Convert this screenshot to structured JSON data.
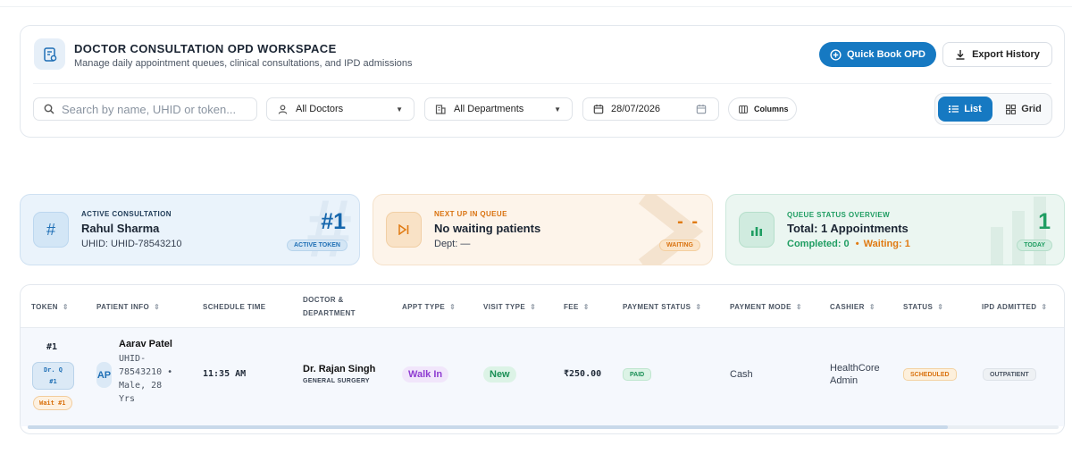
{
  "header": {
    "title": "DOCTOR CONSULTATION OPD WORKSPACE",
    "subtitle": "Manage daily appointment queues, clinical consultations, and IPD admissions",
    "quick_book_label": "Quick Book OPD",
    "export_label": "Export History"
  },
  "filters": {
    "search_placeholder": "Search by name, UHID or token...",
    "doctor_value": "All Doctors",
    "department_value": "All Departments",
    "date_value": "28/07/2026",
    "columns_label": "Columns",
    "view_list_label": "List",
    "view_grid_label": "Grid"
  },
  "stats": {
    "active": {
      "label": "ACTIVE CONSULTATION",
      "name": "Rahul Sharma",
      "uhid": "UHID: UHID-78543210",
      "big": "#1",
      "badge": "ACTIVE TOKEN",
      "watermark": "#"
    },
    "next": {
      "label": "NEXT UP IN QUEUE",
      "main": "No waiting patients",
      "dept": "Dept: —",
      "big": "- -",
      "badge": "WAITING"
    },
    "overview": {
      "label": "QUEUE STATUS OVERVIEW",
      "main": "Total: 1 Appointments",
      "completed": "Completed: 0",
      "waiting": "Waiting: 1",
      "big": "1",
      "badge": "TODAY"
    }
  },
  "table": {
    "columns": [
      "TOKEN",
      "PATIENT INFO",
      "SCHEDULE TIME",
      "DOCTOR &",
      "DEPARTMENT",
      "APPT TYPE",
      "VISIT TYPE",
      "FEE",
      "PAYMENT STATUS",
      "PAYMENT MODE",
      "CASHIER",
      "STATUS",
      "IPD ADMITTED"
    ],
    "row": {
      "token": "#1",
      "doctor_queue_line1": "Dr. Q",
      "doctor_queue_line2": "#1",
      "wait": "Wait #1",
      "avatar": "AP",
      "patient_name": "Aarav Patel",
      "patient_line1": "UHID-",
      "patient_line2": "78543210 •",
      "patient_line3": "Male, 28",
      "patient_line4": "Yrs",
      "time": "11:35 AM",
      "doctor_name": "Dr. Rajan Singh",
      "department": "GENERAL SURGERY",
      "appt_type": "Walk In",
      "visit_type": "New",
      "fee": "₹250.00",
      "payment_status": "PAID",
      "payment_mode": "Cash",
      "cashier_line1": "HealthCore",
      "cashier_line2": "Admin",
      "status": "SCHEDULED",
      "ipd": "OUTPATIENT"
    }
  },
  "colors": {
    "primary": "#1679c2",
    "orange": "#e07a12",
    "green": "#1f9d62"
  }
}
